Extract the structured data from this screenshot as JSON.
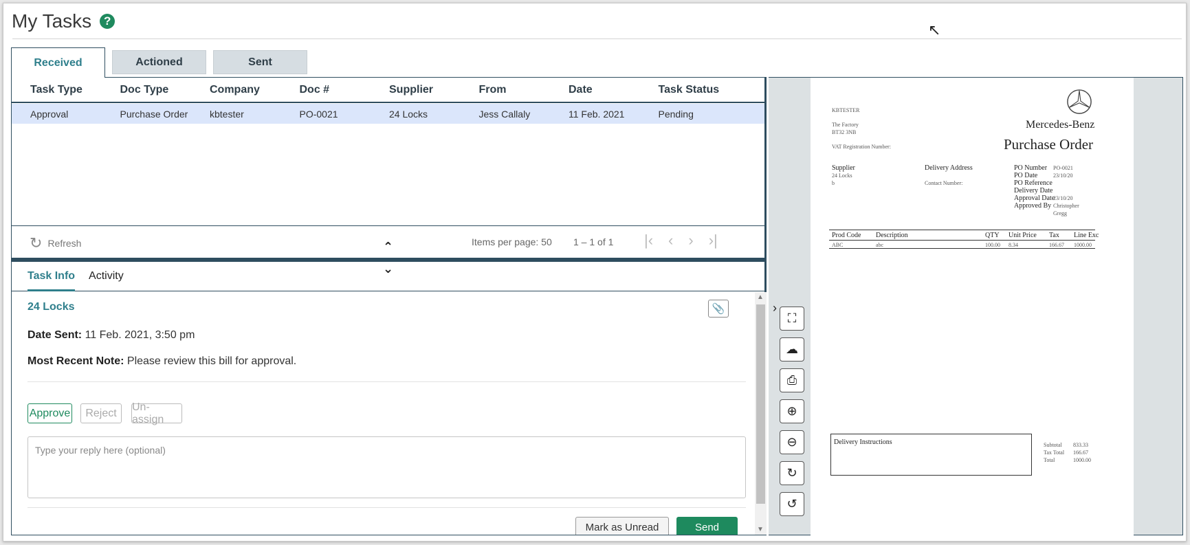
{
  "page": {
    "title": "My Tasks",
    "help_icon": "?"
  },
  "tabs": [
    {
      "label": "Received",
      "active": true
    },
    {
      "label": "Actioned",
      "active": false
    },
    {
      "label": "Sent",
      "active": false
    }
  ],
  "grid": {
    "columns": [
      "Task Type",
      "Doc Type",
      "Company",
      "Doc #",
      "Supplier",
      "From",
      "Date",
      "Task Status"
    ],
    "rows": [
      [
        "Approval",
        "Purchase Order",
        "kbtester",
        "PO-0021",
        "24 Locks",
        "Jess Callaly",
        "11 Feb. 2021",
        "Pending"
      ]
    ],
    "selected_row_color": "#dbe6fb"
  },
  "footer": {
    "refresh_label": "Refresh",
    "items_per_page_label": "Items per page:",
    "items_per_page_value": "50",
    "range": "1 – 1 of 1"
  },
  "subtabs": [
    {
      "label": "Task Info",
      "active": true
    },
    {
      "label": "Activity",
      "active": false
    }
  ],
  "task_info": {
    "supplier": "24 Locks",
    "date_sent_label": "Date Sent:",
    "date_sent_value": "11 Feb. 2021, 3:50 pm",
    "note_label": "Most Recent Note:",
    "note_value": "Please review this bill for approval.",
    "approve": "Approve",
    "reject": "Reject",
    "unassign": "Un-assign",
    "reply_placeholder": "Type your reply here (optional)",
    "mark_unread": "Mark as Unread",
    "send": "Send"
  },
  "document": {
    "company": "KBTESTER",
    "addr1": "The Factory",
    "addr2": "BT32 3NB",
    "vat": "VAT Registration Number:",
    "brand": "Mercedes-Benz",
    "title": "Purchase Order",
    "supplier_label": "Supplier",
    "supplier_name": "24 Locks",
    "supplier_line2": "b",
    "delivery_label": "Delivery Address",
    "contact_label": "Contact Number:",
    "po_number_label": "PO Number",
    "po_number": "PO-0021",
    "po_date_label": "PO Date",
    "po_date": "23/10/20",
    "po_ref_label": "PO Reference",
    "delivery_date_label": "Delivery Date",
    "approval_date_label": "Approval Date",
    "approval_date": "23/10/20",
    "approved_by_label": "Approved By",
    "approved_by_1": "Christopher",
    "approved_by_2": "Gregg",
    "table_headers": [
      "Prod Code",
      "Description",
      "QTY",
      "Unit Price",
      "Tax",
      "Line Exc"
    ],
    "table_row": [
      "ABC",
      "abc",
      "100.00",
      "8.34",
      "166.67",
      "1000.00"
    ],
    "delivery_instructions": "Delivery Instructions",
    "subtotal_label": "Subtotal",
    "subtotal": "833.33",
    "tax_total_label": "Tax Total",
    "tax_total": "166.67",
    "total_label": "Total",
    "total": "1000.00"
  },
  "viewer_tools": [
    "fullscreen-icon",
    "download-icon",
    "print-icon",
    "zoom-in-icon",
    "zoom-out-icon",
    "rotate-right-icon",
    "rotate-left-icon"
  ],
  "colors": {
    "accent": "#2f7f8c",
    "approve": "#1e8a5e",
    "border": "#2e4d5f"
  }
}
